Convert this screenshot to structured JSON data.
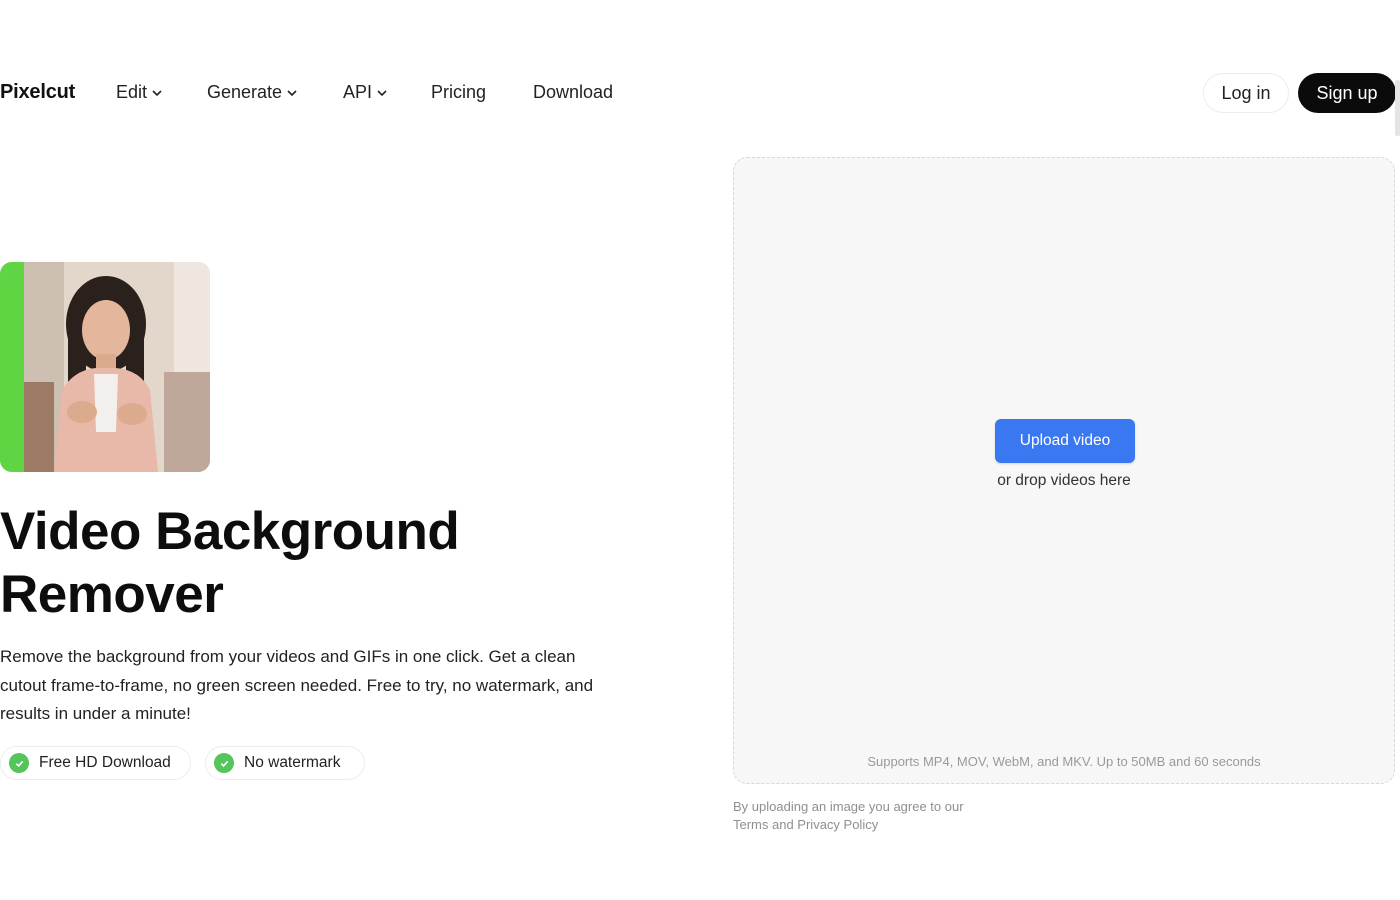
{
  "nav": {
    "logo": "Pixelcut",
    "items": [
      {
        "label": "Edit",
        "has_dropdown": true
      },
      {
        "label": "Generate",
        "has_dropdown": true
      },
      {
        "label": "API",
        "has_dropdown": true
      },
      {
        "label": "Pricing",
        "has_dropdown": false
      },
      {
        "label": "Download",
        "has_dropdown": false
      }
    ],
    "login_label": "Log in",
    "signup_label": "Sign up"
  },
  "hero": {
    "title": "Video Background Remover",
    "description": "Remove the background from your videos and GIFs in one click. Get a clean cutout frame-to-frame, no green screen needed. Free to try, no watermark, and results in under a minute!",
    "badges": [
      {
        "label": "Free HD Download",
        "icon": "check-icon"
      },
      {
        "label": "No watermark",
        "icon": "check-icon"
      }
    ]
  },
  "upload": {
    "button_label": "Upload video",
    "drop_text": "or drop videos here",
    "support_text": "Supports MP4, MOV, WebM, and MKV. Up to 50MB and 60 seconds",
    "terms_text": "By uploading an image you agree to our Terms and Privacy Policy"
  },
  "colors": {
    "accent_blue": "#3a78f2",
    "signup_bg": "#0b0b0b",
    "green_screen": "#5fd544",
    "check_green": "#55c45a"
  }
}
